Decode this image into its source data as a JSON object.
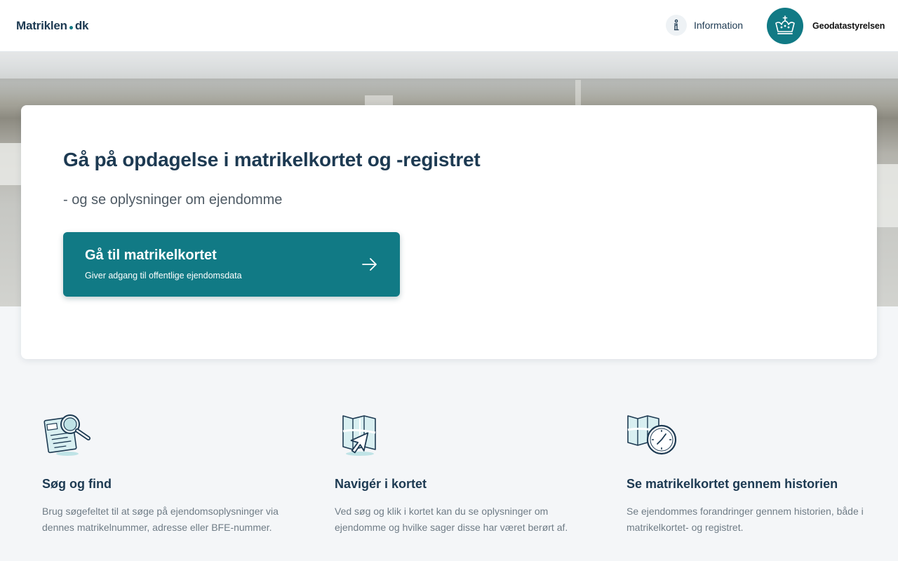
{
  "header": {
    "logo_left": "Matriklen",
    "logo_right": "dk",
    "info_label": "Information",
    "agency_label": "Geodatastyrelsen"
  },
  "hero": {
    "title": "Gå på opdagelse i matrikelkortet og -registret",
    "subtitle": "- og se oplysninger om ejendomme",
    "cta_title": "Gå til matrikelkortet",
    "cta_subtitle": "Giver adgang til offentlige ejendomsdata"
  },
  "features": [
    {
      "icon": "search-document-icon",
      "title": "Søg og find",
      "text": "Brug søgefeltet til at søge på ejendomsoplysninger via dennes matrikelnummer, adresse eller BFE-nummer."
    },
    {
      "icon": "map-cursor-icon",
      "title": "Navigér i kortet",
      "text": "Ved søg og klik i kortet kan du se oplysninger om ejendomme og hvilke sager disse har været berørt af."
    },
    {
      "icon": "map-clock-icon",
      "title": "Se matrikelkortet gennem historien",
      "text": "Se ejendommes forandringer gennem historien, både i matrikelkortet- og registret."
    }
  ],
  "colors": {
    "brand_teal": "#117a85",
    "navy_text": "#1d3a52",
    "page_bg": "#f4f6f8"
  }
}
